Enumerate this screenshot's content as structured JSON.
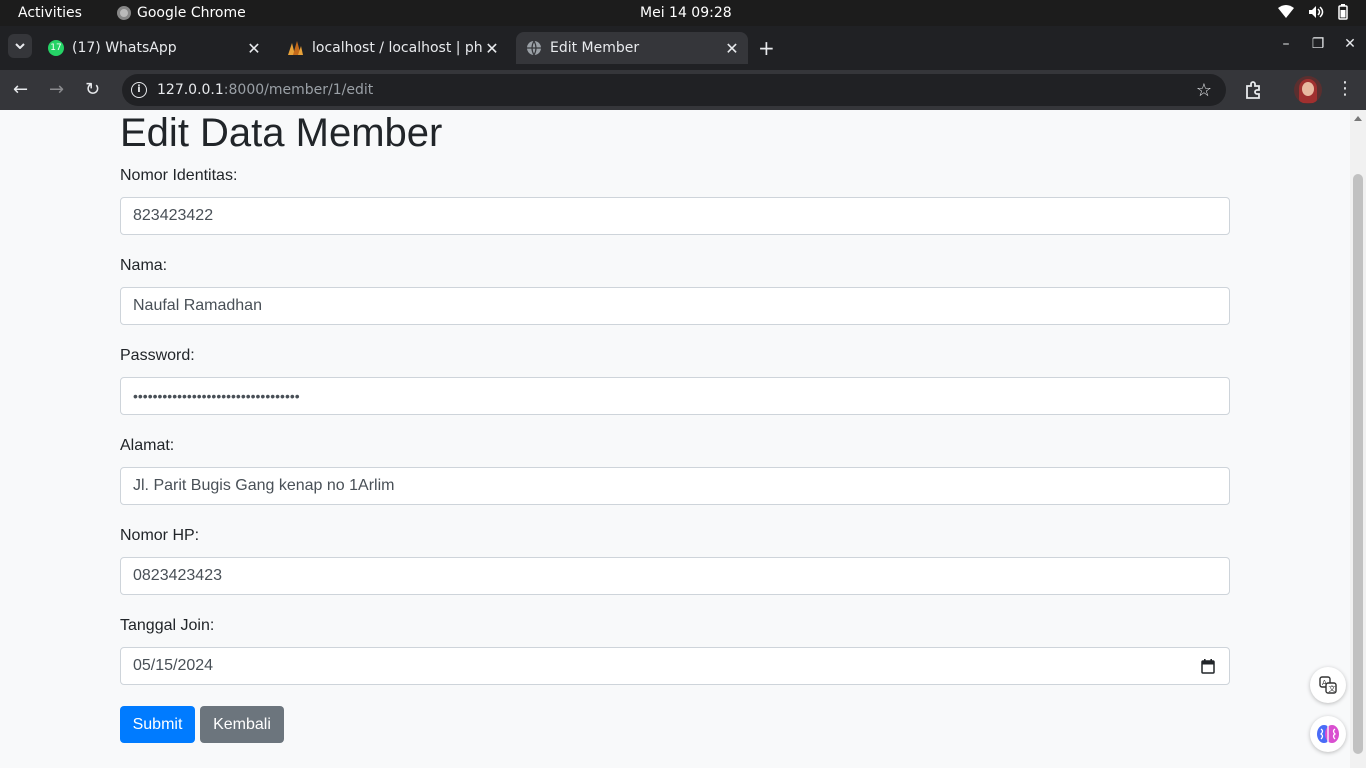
{
  "system": {
    "activities": "Activities",
    "app_name": "Google Chrome",
    "clock": "Mei 14  09:28"
  },
  "browser": {
    "tabs": [
      {
        "label": "(17) WhatsApp",
        "icon": "whatsapp-icon",
        "badge": "17"
      },
      {
        "label": "localhost / localhost | ph",
        "icon": "phpmyadmin-icon"
      },
      {
        "label": "Edit Member",
        "icon": "globe-icon",
        "active": true
      }
    ],
    "url_host": "127.0.0.1",
    "url_path": ":8000/member/1/edit"
  },
  "page": {
    "title": "Edit Data Member",
    "fields": [
      {
        "label": "Nomor Identitas:",
        "value": "823423422"
      },
      {
        "label": "Nama:",
        "value": "Naufal Ramadhan"
      },
      {
        "label": "Password:",
        "value": "••••••••••••••••••••••••••••••••••"
      },
      {
        "label": "Alamat:",
        "value": "Jl. Parit Bugis Gang kenap no 1Arlim"
      },
      {
        "label": "Nomor HP:",
        "value": "0823423423"
      },
      {
        "label": "Tanggal Join:",
        "value": "05/15/2024"
      }
    ],
    "submit_label": "Submit",
    "back_label": "Kembali"
  },
  "colors": {
    "primary": "#007bff",
    "secondary": "#6c757d",
    "page_bg": "#f8f9fa"
  }
}
